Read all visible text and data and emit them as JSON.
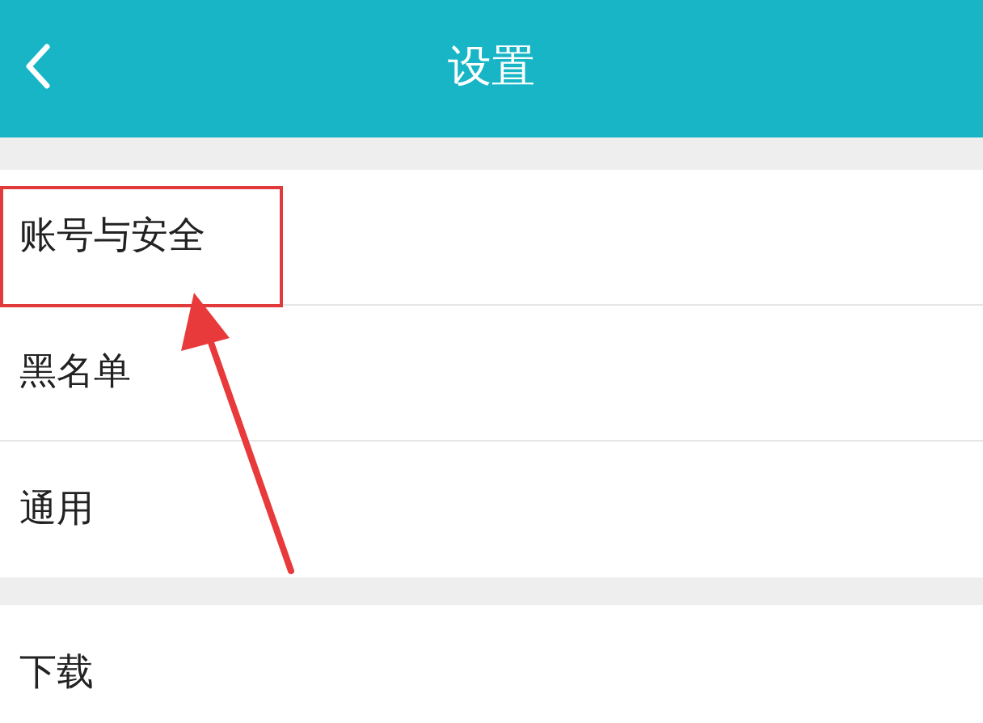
{
  "header": {
    "title": "设置"
  },
  "sections": [
    {
      "rows": [
        {
          "label": "账号与安全",
          "highlighted": true
        },
        {
          "label": "黑名单",
          "highlighted": false
        },
        {
          "label": "通用",
          "highlighted": false
        }
      ]
    },
    {
      "rows": [
        {
          "label": "下载",
          "highlighted": false
        }
      ]
    }
  ]
}
